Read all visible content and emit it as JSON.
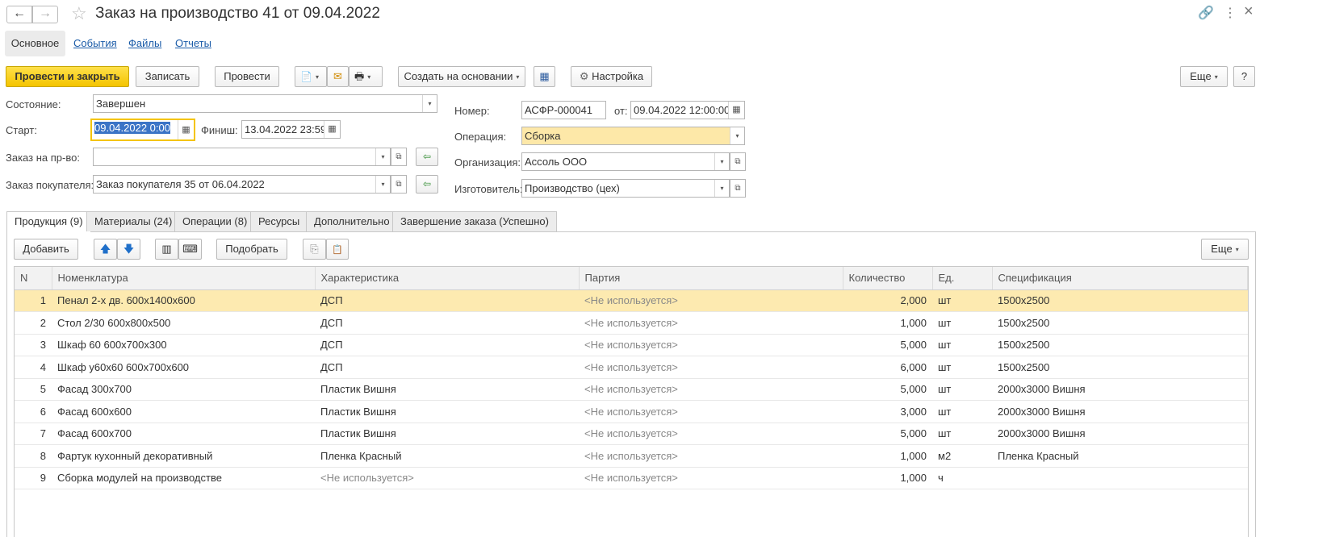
{
  "window": {
    "title": "Заказ на производство 41 от 09.04.2022",
    "back_icon": "←",
    "forward_icon": "→",
    "star_icon": "☆",
    "link_icon": "🔗",
    "more_icon": "⋮",
    "close_icon": "×"
  },
  "sections": {
    "main": "Основное",
    "events": "События",
    "files": "Файлы",
    "reports": "Отчеты"
  },
  "toolbar": {
    "post_close": "Провести и закрыть",
    "save": "Записать",
    "post": "Провести",
    "create_based": "Создать на основании",
    "settings": "Настройка",
    "more": "Еще",
    "help": "?",
    "gear_icon": "⚙",
    "doc_icon": "📄",
    "mail_icon": "✉",
    "print_icon": "🖶",
    "struct_icon": "▦",
    "caret": "▾"
  },
  "form": {
    "state_label": "Состояние:",
    "state_value": "Завершен",
    "start_label": "Старт:",
    "start_value": "09.04.2022  0:00",
    "finish_label": "Финиш:",
    "finish_value": "13.04.2022 23:59",
    "prod_order_label": "Заказ на пр-во:",
    "prod_order_value": "",
    "customer_order_label": "Заказ покупателя:",
    "customer_order_value": "Заказ покупателя 35 от 06.04.2022",
    "number_label": "Номер:",
    "number_value": "АСФР-000041",
    "from_label": "от:",
    "from_value": "09.04.2022 12:00:00",
    "operation_label": "Операция:",
    "operation_value": "Сборка",
    "org_label": "Организация:",
    "org_value": "Ассоль ООО",
    "maker_label": "Изготовитель:",
    "maker_value": "Производство (цех)",
    "calendar_icon": "▦",
    "open_icon": "⧉",
    "green_icon": "⇦",
    "caret": "▾"
  },
  "tabs": [
    "Продукция (9)",
    "Материалы (24)",
    "Операции (8)",
    "Ресурсы",
    "Дополнительно",
    "Завершение заказа (Успешно)"
  ],
  "grid_toolbar": {
    "add": "Добавить",
    "pick": "Подобрать",
    "more": "Еще",
    "up_icon": "🡅",
    "down_icon": "🡇",
    "barcode_icon": "▥",
    "scan_icon": "⌨",
    "copy_icon": "⎘",
    "paste_icon": "📋",
    "caret": "▾"
  },
  "grid": {
    "columns": [
      "N",
      "Номенклатура",
      "Характеристика",
      "Партия",
      "Количество",
      "Ед.",
      "Спецификация"
    ],
    "rows": [
      [
        "1",
        "Пенал 2-х дв. 600х1400х600",
        "ДСП",
        "<Не используется>",
        "2,000",
        "шт",
        "1500х2500"
      ],
      [
        "2",
        "Стол 2/30 600х800х500",
        "ДСП",
        "<Не используется>",
        "1,000",
        "шт",
        "1500х2500"
      ],
      [
        "3",
        "Шкаф 60 600х700х300",
        "ДСП",
        "<Не используется>",
        "5,000",
        "шт",
        "1500х2500"
      ],
      [
        "4",
        "Шкаф у60х60 600х700х600",
        "ДСП",
        "<Не используется>",
        "6,000",
        "шт",
        "1500х2500"
      ],
      [
        "5",
        "Фасад 300х700",
        "Пластик Вишня",
        "<Не используется>",
        "5,000",
        "шт",
        "2000х3000 Вишня"
      ],
      [
        "6",
        "Фасад 600х600",
        "Пластик Вишня",
        "<Не используется>",
        "3,000",
        "шт",
        "2000х3000 Вишня"
      ],
      [
        "7",
        "Фасад 600х700",
        "Пластик Вишня",
        "<Не используется>",
        "5,000",
        "шт",
        "2000х3000 Вишня"
      ],
      [
        "8",
        "Фартук кухонный декоративный",
        "Пленка Красный",
        "<Не используется>",
        "1,000",
        "м2",
        "Пленка Красный"
      ],
      [
        "9",
        "Сборка модулей на производстве",
        "<Не используется>",
        "<Не используется>",
        "1,000",
        "ч",
        ""
      ]
    ],
    "selected_row": 0
  }
}
